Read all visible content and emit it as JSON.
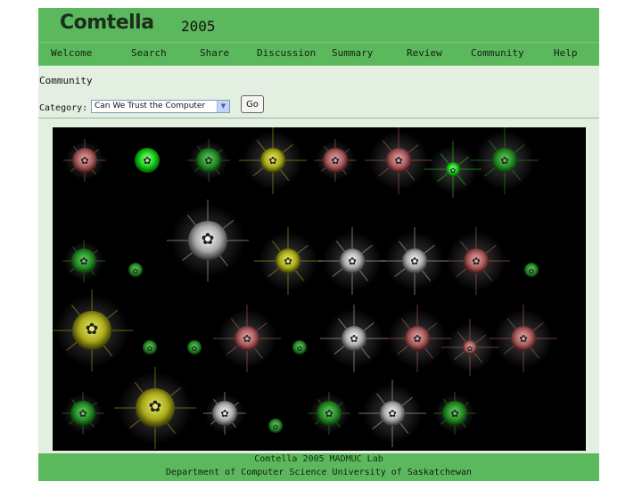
{
  "header": {
    "logo": "Comtella",
    "year": "2005"
  },
  "nav": [
    "Welcome",
    "Search",
    "Share",
    "Discussion",
    "Summary",
    "Review",
    "Community",
    "Help"
  ],
  "page": {
    "title": "Community",
    "category_label": "Category:",
    "category_value": "Can We Trust the Computer",
    "go_label": "Go"
  },
  "footer": {
    "line1": "Comtella 2005 MADMUC Lab",
    "line2": "Department of Computer Science  University of Saskatchewan"
  },
  "palette": {
    "header_green": "#5cb85c",
    "panel_bg": "#e3efe1",
    "viz_bg": "#000000",
    "star_red": "#b86a6a",
    "star_green": "#2e9a2e",
    "star_bright_green": "#22dd22",
    "star_yellow": "#b5b520",
    "star_white": "#c8c8c8"
  },
  "stars": [
    {
      "color": "red",
      "size": "medium",
      "rays": "short"
    },
    {
      "color": "bright-green",
      "size": "medium",
      "rays": "none"
    },
    {
      "color": "green",
      "size": "medium",
      "rays": "short"
    },
    {
      "color": "yellow",
      "size": "medium",
      "rays": "long"
    },
    {
      "color": "red",
      "size": "medium",
      "rays": "short"
    },
    {
      "color": "red",
      "size": "medium",
      "rays": "long"
    },
    {
      "color": "bright-green",
      "size": "small",
      "rays": "long"
    },
    {
      "color": "green",
      "size": "medium",
      "rays": "long"
    },
    {
      "color": "white",
      "size": "large",
      "rays": "long"
    },
    {
      "color": "green",
      "size": "medium",
      "rays": "short"
    },
    {
      "color": "green",
      "size": "small",
      "rays": "none"
    },
    {
      "color": "yellow",
      "size": "medium",
      "rays": "long"
    },
    {
      "color": "white",
      "size": "medium",
      "rays": "long"
    },
    {
      "color": "white",
      "size": "medium",
      "rays": "long"
    },
    {
      "color": "red",
      "size": "medium",
      "rays": "long"
    },
    {
      "color": "green",
      "size": "small",
      "rays": "none"
    },
    {
      "color": "yellow",
      "size": "large",
      "rays": "long"
    },
    {
      "color": "green",
      "size": "small",
      "rays": "none"
    },
    {
      "color": "green",
      "size": "small",
      "rays": "none"
    },
    {
      "color": "red",
      "size": "medium",
      "rays": "long"
    },
    {
      "color": "green",
      "size": "small",
      "rays": "none"
    },
    {
      "color": "white",
      "size": "medium",
      "rays": "long"
    },
    {
      "color": "red",
      "size": "medium",
      "rays": "long"
    },
    {
      "color": "red",
      "size": "small",
      "rays": "long"
    },
    {
      "color": "red",
      "size": "medium",
      "rays": "long"
    },
    {
      "color": "green",
      "size": "medium",
      "rays": "short"
    },
    {
      "color": "yellow",
      "size": "large",
      "rays": "long"
    },
    {
      "color": "white",
      "size": "medium",
      "rays": "short"
    },
    {
      "color": "green",
      "size": "small",
      "rays": "none"
    },
    {
      "color": "green",
      "size": "medium",
      "rays": "short"
    },
    {
      "color": "white",
      "size": "medium",
      "rays": "long"
    },
    {
      "color": "green",
      "size": "medium",
      "rays": "short"
    }
  ]
}
